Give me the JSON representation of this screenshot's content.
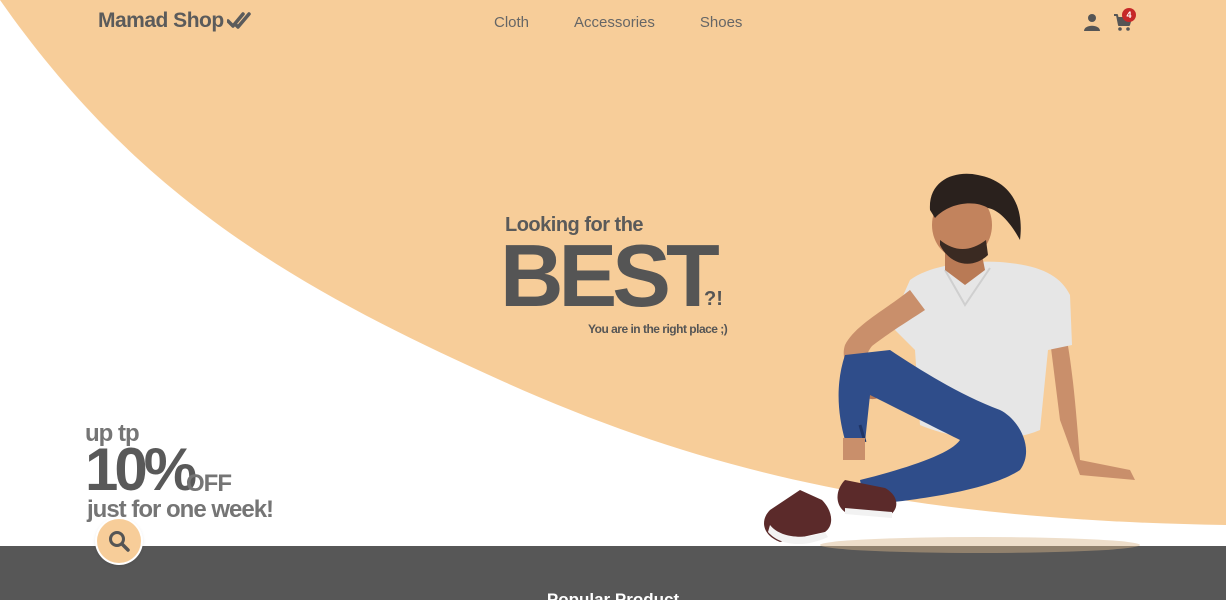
{
  "brand": {
    "name": "Mamad Shop",
    "icon": "double-check-icon"
  },
  "nav": {
    "items": [
      "Cloth",
      "Accessories",
      "Shoes"
    ]
  },
  "header": {
    "user_icon": "user-icon",
    "cart_icon": "cart-icon",
    "cart_count": "4"
  },
  "hero": {
    "subtitle": "Looking for the",
    "headline": "BEST",
    "punctuation": "?!",
    "tagline": "You are in the right place ;)"
  },
  "offer": {
    "line1": "up tp",
    "percent": "10%",
    "off": "OFF",
    "line3": "just for one week!"
  },
  "search": {
    "icon": "search-icon"
  },
  "section": {
    "title": "Popular Product"
  },
  "colors": {
    "accent": "#f7cd99",
    "text": "#555555",
    "band": "#575757",
    "badge": "#c62828"
  }
}
